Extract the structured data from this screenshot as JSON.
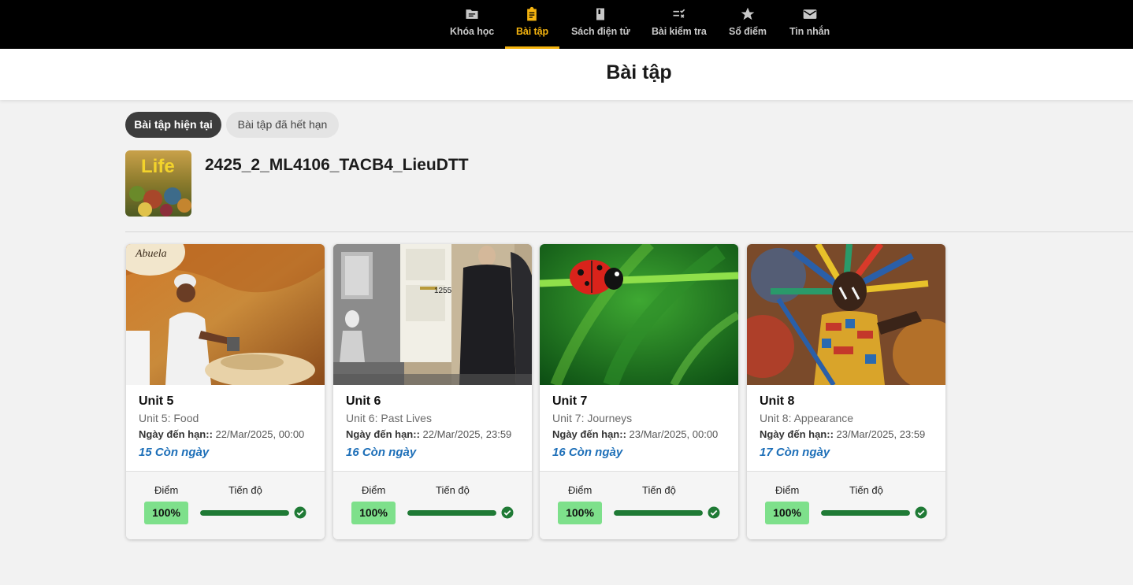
{
  "nav": {
    "items": [
      {
        "label": "Khóa học",
        "icon": "folder-icon",
        "active": false
      },
      {
        "label": "Bài tập",
        "icon": "clipboard-icon",
        "active": true
      },
      {
        "label": "Sách điện tử",
        "icon": "book-icon",
        "active": false
      },
      {
        "label": "Bài kiểm tra",
        "icon": "checklist-icon",
        "active": false
      },
      {
        "label": "Sổ điểm",
        "icon": "star-icon",
        "active": false
      },
      {
        "label": "Tin nhắn",
        "icon": "mail-icon",
        "active": false
      }
    ]
  },
  "page": {
    "title": "Bài tập"
  },
  "filters": {
    "current": "Bài tập hiện tại",
    "expired": "Bài tập đã hết hạn",
    "selected": "current"
  },
  "course": {
    "name": "2425_2_ML4106_TACB4_LieuDTT",
    "thumb_text": "Life"
  },
  "cards": [
    {
      "unit": "Unit 5",
      "subtitle": "Unit 5: Food",
      "due_label": "Ngày đến hạn::",
      "due": "22/Mar/2025, 00:00",
      "remaining": "15 Còn ngày",
      "score_label": "Điểm",
      "score": "100%",
      "progress_label": "Tiến độ",
      "progress": 1.0,
      "image_text": "Abuela"
    },
    {
      "unit": "Unit 6",
      "subtitle": "Unit 6: Past Lives",
      "due_label": "Ngày đến hạn::",
      "due": "22/Mar/2025, 23:59",
      "remaining": "16 Còn ngày",
      "score_label": "Điểm",
      "score": "100%",
      "progress_label": "Tiến độ",
      "progress": 1.0,
      "image_text": "1255"
    },
    {
      "unit": "Unit 7",
      "subtitle": "Unit 7: Journeys",
      "due_label": "Ngày đến hạn::",
      "due": "23/Mar/2025, 00:00",
      "remaining": "16 Còn ngày",
      "score_label": "Điểm",
      "score": "100%",
      "progress_label": "Tiến độ",
      "progress": 1.0
    },
    {
      "unit": "Unit 8",
      "subtitle": "Unit 8: Appearance",
      "due_label": "Ngày đến hạn::",
      "due": "23/Mar/2025, 23:59",
      "remaining": "17 Còn ngày",
      "score_label": "Điểm",
      "score": "100%",
      "progress_label": "Tiến độ",
      "progress": 1.0
    }
  ],
  "colors": {
    "nav_bg": "#000000",
    "nav_active": "#f5b40f",
    "remaining": "#1d6fb8",
    "score_bg": "#7ee08b",
    "progress": "#1f7a35"
  }
}
